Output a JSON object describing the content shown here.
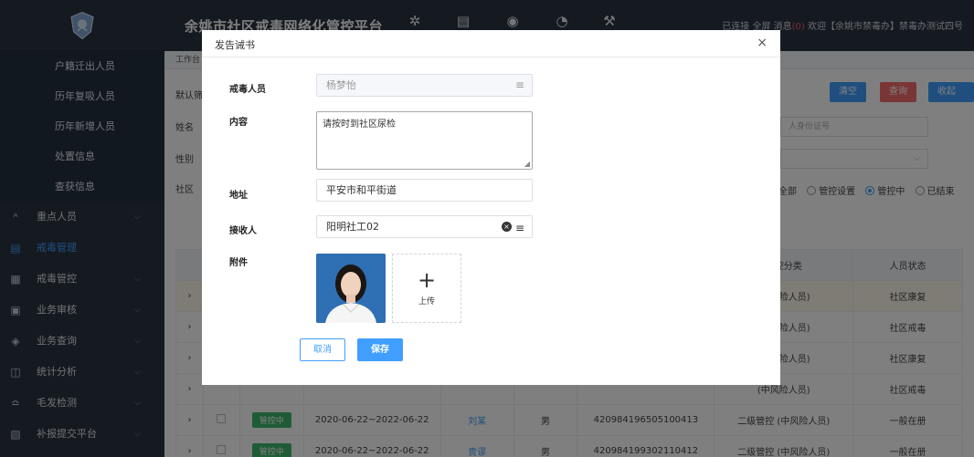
{
  "header": {
    "title": "余姚市社区戒毒网络化管控平台",
    "status_text": "已连接",
    "fullscreen": "全屏",
    "messages": "消息",
    "message_count": "(0)",
    "welcome": "欢迎【余姚市禁毒办】禁毒办测试四号",
    "icons": [
      "gear-icon",
      "document-icon",
      "search-icon",
      "pie-chart-icon",
      "wrench-icon"
    ]
  },
  "sidebar": {
    "sub_items": [
      "户籍迁出人员",
      "历年复吸人员",
      "历年新增人员",
      "处置信息",
      "查获信息"
    ],
    "items": [
      {
        "label": "重点人员",
        "icon": "person-icon",
        "chevron": "⌵"
      },
      {
        "label": "戒毒管理",
        "icon": "form-icon",
        "chevron": ""
      },
      {
        "label": "戒毒管控",
        "icon": "clipboard-icon",
        "chevron": "⌵"
      },
      {
        "label": "业务审核",
        "icon": "audit-icon",
        "chevron": "⌵"
      },
      {
        "label": "业务查询",
        "icon": "query-icon",
        "chevron": "⌵"
      },
      {
        "label": "统计分析",
        "icon": "stats-icon",
        "chevron": "⌵"
      },
      {
        "label": "毛发检测",
        "icon": "hair-test-icon",
        "chevron": "⌵"
      },
      {
        "label": "补报提交平台",
        "icon": "submit-icon",
        "chevron": "⌵"
      }
    ]
  },
  "background": {
    "work_tab": "工作台",
    "filter_labels": [
      "默认筛",
      "姓名",
      "性别",
      "社区"
    ],
    "buttons": {
      "clear": "清空",
      "query": "查询",
      "collapse": "收起 ∧"
    },
    "id_placeholder": "人身份证号",
    "radio_options": [
      "全部",
      "管控设置",
      "管控中",
      "已结束"
    ],
    "radio_selected": "管控中",
    "table_headers": [
      "",
      "",
      "",
      "",
      "",
      "",
      "",
      "管控分类",
      "人员状态"
    ],
    "rows": [
      {
        "expand": "›",
        "status_tag": "",
        "period": "",
        "name": "",
        "gender": "",
        "idno": "",
        "category": "(中风险人员)",
        "state": "社区康复"
      },
      {
        "expand": "›",
        "status_tag": "",
        "period": "",
        "name": "",
        "gender": "",
        "idno": "",
        "category": "(中风险人员)",
        "state": "社区戒毒"
      },
      {
        "expand": "›",
        "status_tag": "",
        "period": "",
        "name": "",
        "gender": "",
        "idno": "",
        "category": "(中风险人员)",
        "state": "社区康复"
      },
      {
        "expand": "›",
        "status_tag": "",
        "period": "",
        "name": "",
        "gender": "",
        "idno": "",
        "category": "(中风险人员)",
        "state": "社区戒毒"
      },
      {
        "expand": "›",
        "status_tag": "管控中",
        "period": "2020-06-22~2022-06-22",
        "name": "刘某",
        "gender": "男",
        "idno": "420984196505100413",
        "category": "二级管控 (中风险人员)",
        "state": "一般在册"
      },
      {
        "expand": "›",
        "status_tag": "管控中",
        "period": "2020-06-22~2022-06-22",
        "name": "贵谬",
        "gender": "男",
        "idno": "420984199302110412",
        "category": "二级管控 (中风险人员)",
        "state": "一般在册"
      }
    ]
  },
  "modal": {
    "title": "发告诫书",
    "close_label": "×",
    "fields": {
      "person_label": "戒毒人员",
      "person_value": "杨梦怡",
      "content_label": "内容",
      "content_value": "请按时到社区尿检",
      "address_label": "地址",
      "address_value": "平安市和平街道",
      "receiver_label": "接收人",
      "receiver_value": "阳明社工02",
      "attachment_label": "附件"
    },
    "upload_plus": "+",
    "upload_label": "上传",
    "cancel_label": "取消",
    "save_label": "保存"
  },
  "colors": {
    "primary": "#409eff",
    "sidebar_bg": "#2b3542",
    "tag_green": "#3fb96d",
    "button_red": "#f56c6c"
  }
}
